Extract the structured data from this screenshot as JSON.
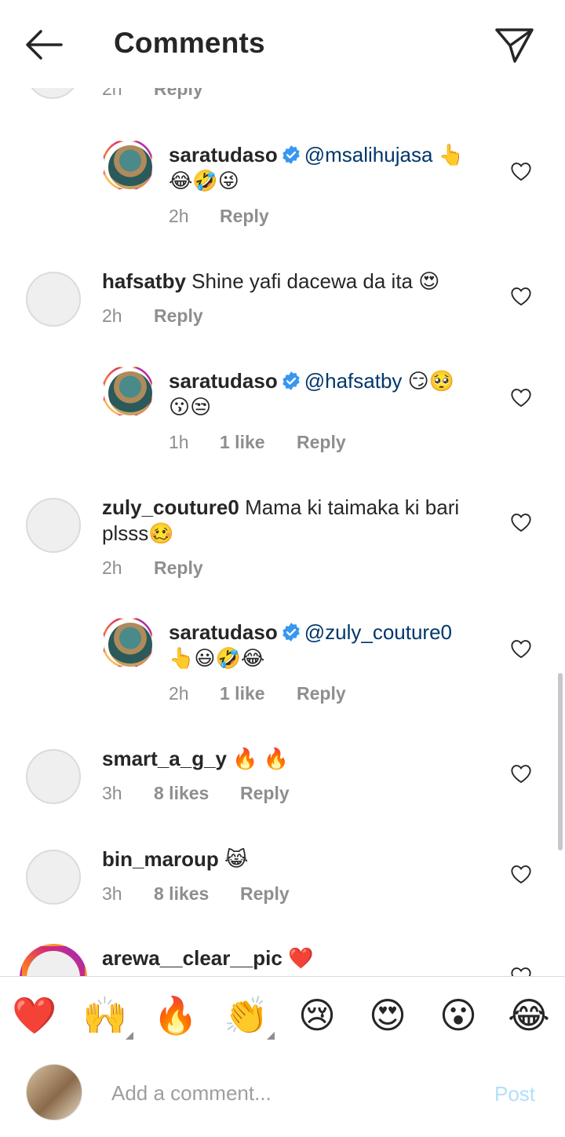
{
  "header": {
    "title": "Comments",
    "back_icon": "back-arrow-icon",
    "send_icon": "paper-plane-icon"
  },
  "top_partial": {
    "time": "2h",
    "reply": "Reply"
  },
  "comments": [
    {
      "username": "saratudaso",
      "verified": true,
      "mention": "@msalihujasa",
      "text": "👆",
      "text2": "😂🤣😜",
      "time": "2h",
      "likes": "",
      "reply": "Reply"
    },
    {
      "username": "hafsatby",
      "verified": false,
      "text": "Shine yafi dacewa da ita 😍",
      "time": "2h",
      "likes": "",
      "reply": "Reply"
    },
    {
      "username": "saratudaso",
      "verified": true,
      "mention": "@hafsatby",
      "text": "😏🥺",
      "text2": "😗😒",
      "time": "1h",
      "likes": "1 like",
      "reply": "Reply"
    },
    {
      "username": "zuly_couture0",
      "verified": false,
      "text": "Mama ki taimaka ki bari",
      "text2": "plsss🥴",
      "time": "2h",
      "likes": "",
      "reply": "Reply"
    },
    {
      "username": "saratudaso",
      "verified": true,
      "mention": "@zuly_couture0",
      "text": "",
      "text2": "👆😃🤣😂",
      "time": "2h",
      "likes": "1 like",
      "reply": "Reply"
    },
    {
      "username": "smart_a_g_y",
      "verified": false,
      "text": "🔥 🔥",
      "time": "3h",
      "likes": "8 likes",
      "reply": "Reply"
    },
    {
      "username": "bin_maroup",
      "verified": false,
      "text": "😹",
      "time": "3h",
      "likes": "8 likes",
      "reply": "Reply"
    },
    {
      "username": "arewa__clear__pic",
      "verified": false,
      "text": "❤️"
    }
  ],
  "emoji_bar": [
    "❤️",
    "🙌",
    "🔥",
    "👏",
    "😢",
    "😍",
    "😮",
    "😂"
  ],
  "composer": {
    "placeholder": "Add a comment...",
    "post_label": "Post"
  }
}
